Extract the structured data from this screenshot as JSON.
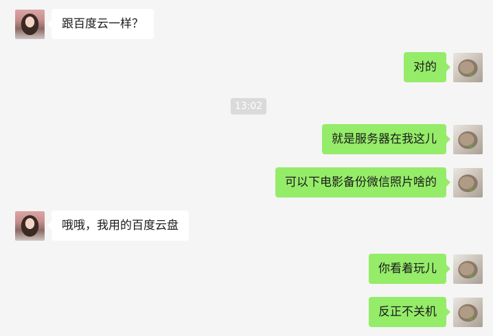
{
  "messages": [
    {
      "side": "left",
      "avatar": "girl-avatar",
      "text": "跟百度云一样？"
    },
    {
      "side": "right",
      "avatar": "cat-avatar",
      "text": "对的"
    },
    {
      "side": "right",
      "avatar": "cat-avatar",
      "text": "就是服务器在我这儿"
    },
    {
      "side": "right",
      "avatar": "cat-avatar",
      "text": "可以下电影备份微信照片啥的"
    },
    {
      "side": "left",
      "avatar": "girl-avatar",
      "text": "哦哦，我用的百度云盘"
    },
    {
      "side": "right",
      "avatar": "cat-avatar",
      "text": "你看着玩儿"
    },
    {
      "side": "right",
      "avatar": "cat-avatar",
      "text": "反正不关机"
    }
  ],
  "timestamp": "13:02",
  "colors": {
    "background": "#f5f5f5",
    "sent_bubble": "#95ec69",
    "received_bubble": "#ffffff",
    "timestamp_bg": "#dadada"
  }
}
